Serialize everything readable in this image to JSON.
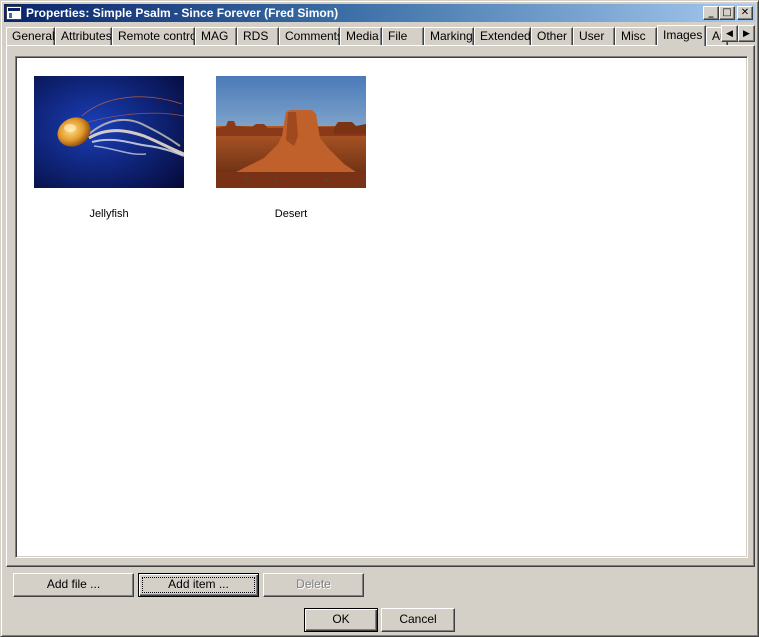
{
  "window": {
    "title": "Properties: Simple Psalm - Since Forever (Fred Simon)",
    "caption_buttons": {
      "minimize": "_",
      "maximize": "□",
      "close": "✕"
    }
  },
  "tabs": [
    {
      "label": "General",
      "active": false
    },
    {
      "label": "Attributes",
      "active": false
    },
    {
      "label": "Remote control",
      "active": false
    },
    {
      "label": "MAG",
      "active": false
    },
    {
      "label": "RDS",
      "active": false
    },
    {
      "label": "Comments",
      "active": false
    },
    {
      "label": "Media",
      "active": false
    },
    {
      "label": "File",
      "active": false
    },
    {
      "label": "Marking",
      "active": false
    },
    {
      "label": "Extended",
      "active": false
    },
    {
      "label": "Other",
      "active": false
    },
    {
      "label": "User",
      "active": false
    },
    {
      "label": "Misc",
      "active": false
    },
    {
      "label": "Images",
      "active": true
    },
    {
      "label": "Au",
      "active": false
    }
  ],
  "tab_scroll": {
    "left": "◀",
    "right": "▶"
  },
  "images": [
    {
      "label": "Jellyfish"
    },
    {
      "label": "Desert"
    }
  ],
  "actions": {
    "add_file": "Add file ...",
    "add_item": "Add item ...",
    "delete": "Delete"
  },
  "dialog": {
    "ok": "OK",
    "cancel": "Cancel"
  },
  "colors": {
    "title_start": "#0a246a",
    "title_end": "#a6caf0",
    "face": "#d4d0c8"
  }
}
